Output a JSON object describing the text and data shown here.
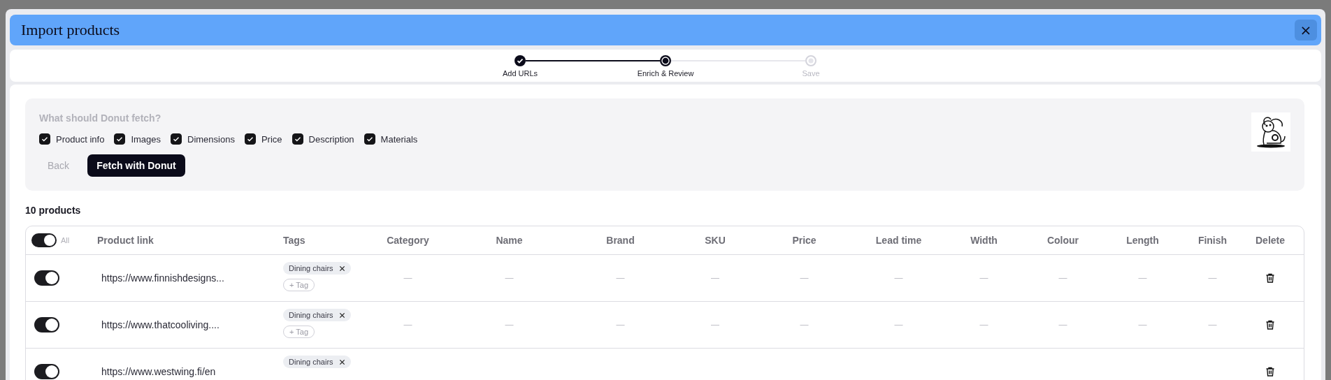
{
  "dialog": {
    "title": "Import products",
    "close": "×"
  },
  "steps": [
    {
      "label": "Add URLs",
      "done": true,
      "selected": false
    },
    {
      "label": "Enrich & Review",
      "done": false,
      "selected": true
    },
    {
      "label": "Save",
      "done": false,
      "selected": false
    }
  ],
  "fetch_panel": {
    "heading": "What should Donut fetch?",
    "options": [
      {
        "label": "Product info",
        "checked": true
      },
      {
        "label": "Images",
        "checked": true
      },
      {
        "label": "Dimensions",
        "checked": true
      },
      {
        "label": "Price",
        "checked": true
      },
      {
        "label": "Description",
        "checked": true
      },
      {
        "label": "Materials",
        "checked": true
      }
    ],
    "back_button": "Back",
    "fetch_button": "Fetch with Donut"
  },
  "product_count": "10 products",
  "table": {
    "select_all": {
      "label": "All",
      "on": true
    },
    "columns": [
      "Product link",
      "Tags",
      "Category",
      "Name",
      "Brand",
      "SKU",
      "Price",
      "Lead time",
      "Width",
      "Colour",
      "Length",
      "Finish",
      "Delete"
    ],
    "rows": [
      {
        "on": true,
        "link": "https://www.finnishdesigns...",
        "tags": [
          "Dining chairs"
        ],
        "add_tag": "+ Tag",
        "values": [
          "—",
          "—",
          "—",
          "—",
          "—",
          "—",
          "—",
          "—",
          "—",
          "—"
        ]
      },
      {
        "on": true,
        "link": "https://www.thatcooliving....",
        "tags": [
          "Dining chairs"
        ],
        "add_tag": "+ Tag",
        "values": [
          "—",
          "—",
          "—",
          "—",
          "—",
          "—",
          "—",
          "—",
          "—",
          "—"
        ]
      },
      {
        "on": true,
        "link": "https://www.westwing.fi/en",
        "tags": [
          "Dining chairs"
        ],
        "values": []
      }
    ]
  }
}
